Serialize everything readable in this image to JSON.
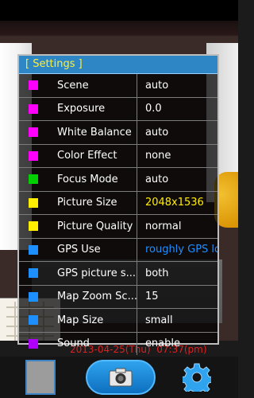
{
  "panel": {
    "title": "[ Settings ]",
    "rows": [
      {
        "label": "Scene",
        "value": "auto",
        "color": "#ff00ff"
      },
      {
        "label": "Exposure",
        "value": "0.0",
        "color": "#ff00ff"
      },
      {
        "label": "White Balance",
        "value": "auto",
        "color": "#ff00ff"
      },
      {
        "label": "Color Effect",
        "value": "none",
        "color": "#ff00ff"
      },
      {
        "label": "Focus Mode",
        "value": "auto",
        "color": "#00d000"
      },
      {
        "label": "Picture Size",
        "value": "2048x1536",
        "color": "#ffee00",
        "value_color": "#ffee00"
      },
      {
        "label": "Picture Quality",
        "value": "normal",
        "color": "#ffee00"
      },
      {
        "label": "GPS Use",
        "value": "roughly GPS lo...",
        "color": "#1e8fff",
        "value_color": "#1e8fff"
      },
      {
        "label": "GPS picture s...",
        "value": "both",
        "color": "#1e8fff"
      },
      {
        "label": "Map Zoom Sc...",
        "value": "15",
        "color": "#1e8fff"
      },
      {
        "label": "Map Size",
        "value": "small",
        "color": "#1e8fff"
      },
      {
        "label": "Sound",
        "value": "enable",
        "color": "#b000ff"
      }
    ]
  },
  "preview": {
    "timestamp": "2013-04-25(Thu)  07:37(pm)"
  },
  "toolbar": {
    "thumbnail_icon": "gallery-thumbnail",
    "shutter_icon": "camera-icon",
    "settings_icon": "gear-icon",
    "accent": "#2fa3ee"
  }
}
